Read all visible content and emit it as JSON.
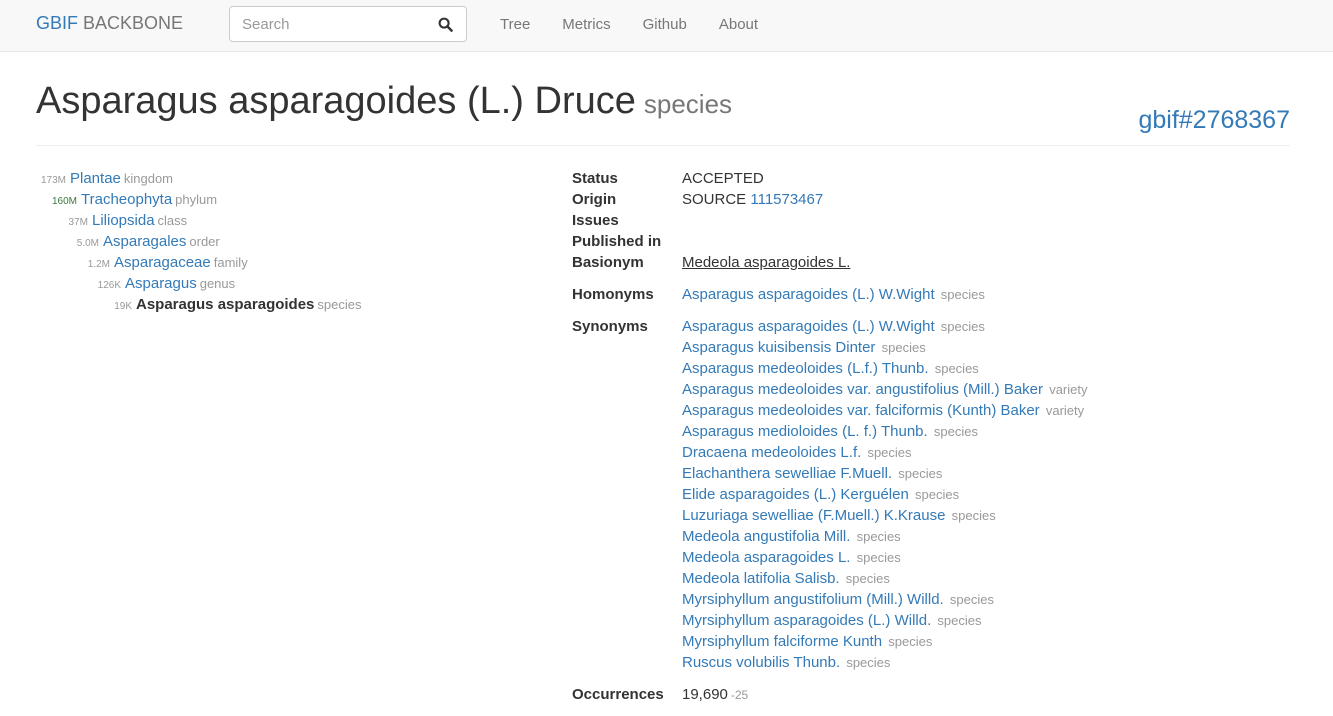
{
  "navbar": {
    "brand_gbif": "GBIF",
    "brand_rest": " BACKBONE",
    "search_placeholder": "Search",
    "links": [
      "Tree",
      "Metrics",
      "Github",
      "About"
    ]
  },
  "taxon": {
    "name": "Asparagus asparagoides (L.) Druce",
    "rank": "species",
    "id": "gbif#2768367"
  },
  "classification": [
    {
      "count": "173M",
      "name": "Plantae",
      "rank": "kingdom"
    },
    {
      "count": "160M",
      "name": "Tracheophyta",
      "rank": "phylum"
    },
    {
      "count": "37M",
      "name": "Liliopsida",
      "rank": "class"
    },
    {
      "count": "5.0M",
      "name": "Asparagales",
      "rank": "order"
    },
    {
      "count": "1.2M",
      "name": "Asparagaceae",
      "rank": "family"
    },
    {
      "count": "126K",
      "name": "Asparagus",
      "rank": "genus"
    },
    {
      "count": "19K",
      "name": "Asparagus asparagoides",
      "rank": "species"
    }
  ],
  "details": {
    "status_label": "Status",
    "status_value": "ACCEPTED",
    "origin_label": "Origin",
    "origin_value": "SOURCE",
    "origin_link": "111573467",
    "issues_label": "Issues",
    "published_label": "Published in",
    "basionym_label": "Basionym",
    "basionym_value": "Medeola asparagoides L.",
    "homonyms_label": "Homonyms",
    "homonyms": [
      {
        "name": "Asparagus asparagoides (L.) W.Wight",
        "rank": "species"
      }
    ],
    "synonyms_label": "Synonyms",
    "synonyms": [
      {
        "name": "Asparagus asparagoides (L.) W.Wight",
        "rank": "species"
      },
      {
        "name": "Asparagus kuisibensis Dinter",
        "rank": "species"
      },
      {
        "name": "Asparagus medeoloides (L.f.) Thunb.",
        "rank": "species"
      },
      {
        "name": "Asparagus medeoloides var. angustifolius (Mill.) Baker",
        "rank": "variety"
      },
      {
        "name": "Asparagus medeoloides var. falciformis (Kunth) Baker",
        "rank": "variety"
      },
      {
        "name": "Asparagus medioloides (L. f.) Thunb.",
        "rank": "species"
      },
      {
        "name": "Dracaena medeoloides L.f.",
        "rank": "species"
      },
      {
        "name": "Elachanthera sewelliae F.Muell.",
        "rank": "species"
      },
      {
        "name": "Elide asparagoides (L.) Kerguélen",
        "rank": "species"
      },
      {
        "name": "Luzuriaga sewelliae (F.Muell.) K.Krause",
        "rank": "species"
      },
      {
        "name": "Medeola angustifolia Mill.",
        "rank": "species"
      },
      {
        "name": "Medeola asparagoides L.",
        "rank": "species"
      },
      {
        "name": "Medeola latifolia Salisb.",
        "rank": "species"
      },
      {
        "name": "Myrsiphyllum angustifolium (Mill.) Willd.",
        "rank": "species"
      },
      {
        "name": "Myrsiphyllum asparagoides (L.) Willd.",
        "rank": "species"
      },
      {
        "name": "Myrsiphyllum falciforme Kunth",
        "rank": "species"
      },
      {
        "name": "Ruscus volubilis Thunb.",
        "rank": "species"
      }
    ],
    "occurrences_label": "Occurrences",
    "occurrences_value": "19,690",
    "occurrences_delta": "-25"
  }
}
